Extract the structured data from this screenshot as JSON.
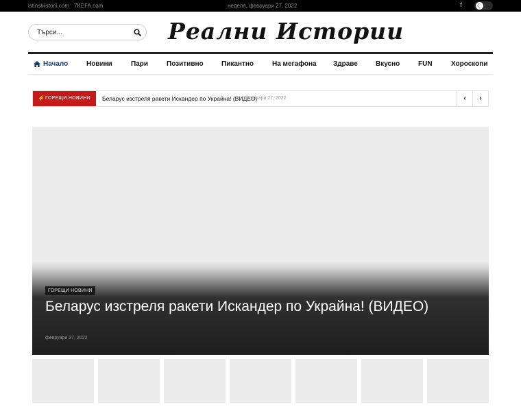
{
  "topbar": {
    "links": [
      "istinskiistorii.com",
      "7KEFA.com"
    ],
    "date": "неделя, февруари 27, 2022",
    "facebook": "f"
  },
  "search": {
    "placeholder": "Търси..."
  },
  "logo": {
    "text": "Реални Истории"
  },
  "nav": {
    "items": [
      "Начало",
      "Новини",
      "Пари",
      "Позитивно",
      "Пикантно",
      "На мегафона",
      "Здраве",
      "Вкусно",
      "FUN",
      "Хороскопи"
    ]
  },
  "ticker": {
    "label": "ГОРЕЩИ НОВИНИ",
    "headline": "Беларус изстреля ракети Искандер по Украйна! (ВИДЕО)",
    "date": "февруари 27, 2022",
    "prev": "‹",
    "next": "›"
  },
  "hero": {
    "category": "ГОРЕЩИ НОВИНИ",
    "title": "Беларус изстреля ракети Искандер по Украйна! (ВИДЕО)",
    "date": "февруари 27, 2022"
  },
  "colors": {
    "topbar": "#000000",
    "accent_red": "#c41a1a",
    "nav_home": "#1e3a7a",
    "placeholder_gray": "#ececec"
  },
  "icons": [
    "search-icon",
    "home-icon",
    "facebook-icon",
    "moon-icon",
    "bolt-icon",
    "chevron-left-icon",
    "chevron-right-icon"
  ]
}
